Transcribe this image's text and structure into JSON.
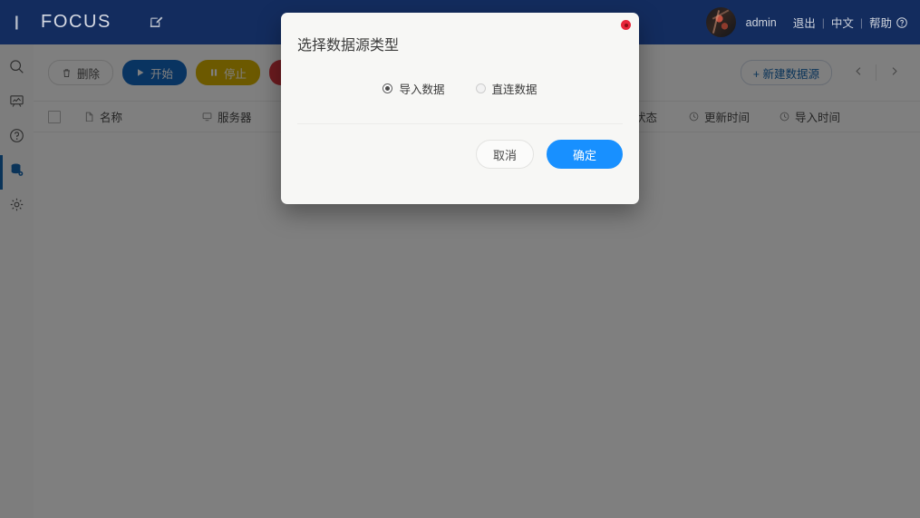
{
  "header": {
    "brand": "FOCUS",
    "logo_icon": "crescent-moon-icon",
    "edit_icon": "edit-square-icon",
    "user": "admin",
    "logout": "退出",
    "language": "中文",
    "help": "帮助",
    "separator": "|",
    "help_icon": "help-circle-icon",
    "bg_color": "#132c5e"
  },
  "sidebar": {
    "items": [
      {
        "name": "search",
        "icon": "search-icon",
        "active": false
      },
      {
        "name": "dashboard",
        "icon": "presentation-chart-icon",
        "active": false
      },
      {
        "name": "help",
        "icon": "question-circle-icon",
        "active": false
      },
      {
        "name": "datasource",
        "icon": "database-icon",
        "active": true
      },
      {
        "name": "settings",
        "icon": "gear-icon",
        "active": false
      }
    ],
    "active_color": "#1668b3"
  },
  "toolbar": {
    "delete_label": "删除",
    "delete_icon": "trash-icon",
    "start_label": "开始",
    "start_icon": "play-icon",
    "stop_label": "停止",
    "stop_icon": "pause-icon",
    "red_label": "",
    "red_icon": "stop-square-icon",
    "new_datasource_label": "+ 新建数据源",
    "prev_icon": "chevron-left-icon",
    "next_icon": "chevron-right-icon"
  },
  "table": {
    "select_all": "",
    "columns": [
      {
        "label": "名称",
        "icon": "file-icon"
      },
      {
        "label": "服务器",
        "icon": "monitor-icon"
      },
      {
        "label": "",
        "icon": "share-icon"
      },
      {
        "label": "导入状态",
        "icon": "bulb-icon"
      },
      {
        "label": "更新时间",
        "icon": "clock-icon"
      },
      {
        "label": "导入时间",
        "icon": "clock-icon"
      }
    ],
    "rows": []
  },
  "modal": {
    "title": "选择数据源类型",
    "close_icon": "close-dot-icon",
    "options": [
      {
        "label": "导入数据",
        "selected": true
      },
      {
        "label": "直连数据",
        "selected": false
      }
    ],
    "cancel_label": "取消",
    "confirm_label": "确定",
    "confirm_color": "#1890ff"
  }
}
